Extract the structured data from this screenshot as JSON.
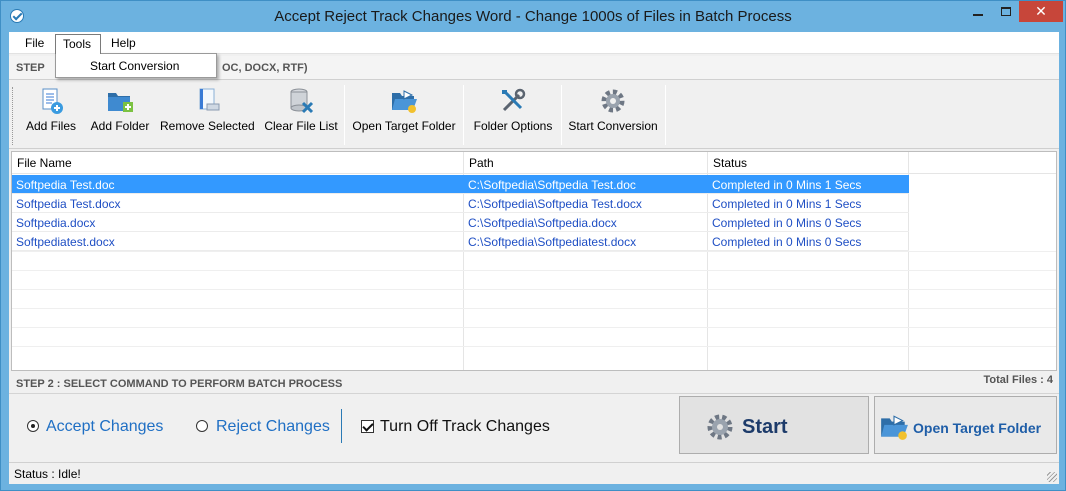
{
  "window": {
    "title": "Accept Reject Track Changes Word - Change 1000s of Files in Batch Process",
    "minimize_label": "–",
    "close_label": "✕"
  },
  "menu": {
    "file": "File",
    "tools": "Tools",
    "help": "Help",
    "dropdown": {
      "start_conversion": "Start Conversion"
    }
  },
  "step1": {
    "label": "STEP",
    "tail": "OC, DOCX, RTF)"
  },
  "toolbar": {
    "add_files": "Add Files",
    "add_folder": "Add Folder",
    "remove_selected": "Remove Selected",
    "clear_file_list": "Clear File List",
    "open_target_folder": "Open Target Folder",
    "folder_options": "Folder Options",
    "start_conversion": "Start Conversion"
  },
  "list": {
    "columns": {
      "name": "File Name",
      "path": "Path",
      "status": "Status"
    },
    "rows": [
      {
        "name": "Softpedia Test.doc",
        "path": "C:\\Softpedia\\Softpedia Test.doc",
        "status": "Completed in 0 Mins 1 Secs",
        "selected": true
      },
      {
        "name": "Softpedia Test.docx",
        "path": "C:\\Softpedia\\Softpedia Test.docx",
        "status": "Completed in 0 Mins 1 Secs",
        "selected": false
      },
      {
        "name": "Softpedia.docx",
        "path": "C:\\Softpedia\\Softpedia.docx",
        "status": "Completed in 0 Mins 0 Secs",
        "selected": false
      },
      {
        "name": "Softpediatest.docx",
        "path": "C:\\Softpedia\\Softpediatest.docx",
        "status": "Completed in 0 Mins 0 Secs",
        "selected": false
      }
    ]
  },
  "step2": {
    "label": "STEP 2 : SELECT COMMAND TO PERFORM BATCH PROCESS",
    "total": "Total Files : 4"
  },
  "options": {
    "accept": {
      "label": "Accept Changes",
      "checked": true
    },
    "reject": {
      "label": "Reject Changes",
      "checked": false
    },
    "track_off": {
      "label": "Turn Off Track Changes",
      "checked": true
    },
    "start_button": "Start",
    "open_button": "Open Target Folder"
  },
  "status": {
    "text": "Status  :  Idle!"
  },
  "colors": {
    "selection": "#3399ff",
    "link_text": "#1f4fc4",
    "close_button": "#c7463a",
    "frame": "#6cb2e0"
  },
  "icons": {
    "app": "check-circle-icon",
    "add_files": "document-add-icon",
    "add_folder": "folder-add-icon",
    "remove_selected": "document-remove-icon",
    "clear_file_list": "database-delete-icon",
    "open_target_folder": "folder-open-icon",
    "folder_options": "tools-icon",
    "start_conversion": "gear-icon"
  }
}
